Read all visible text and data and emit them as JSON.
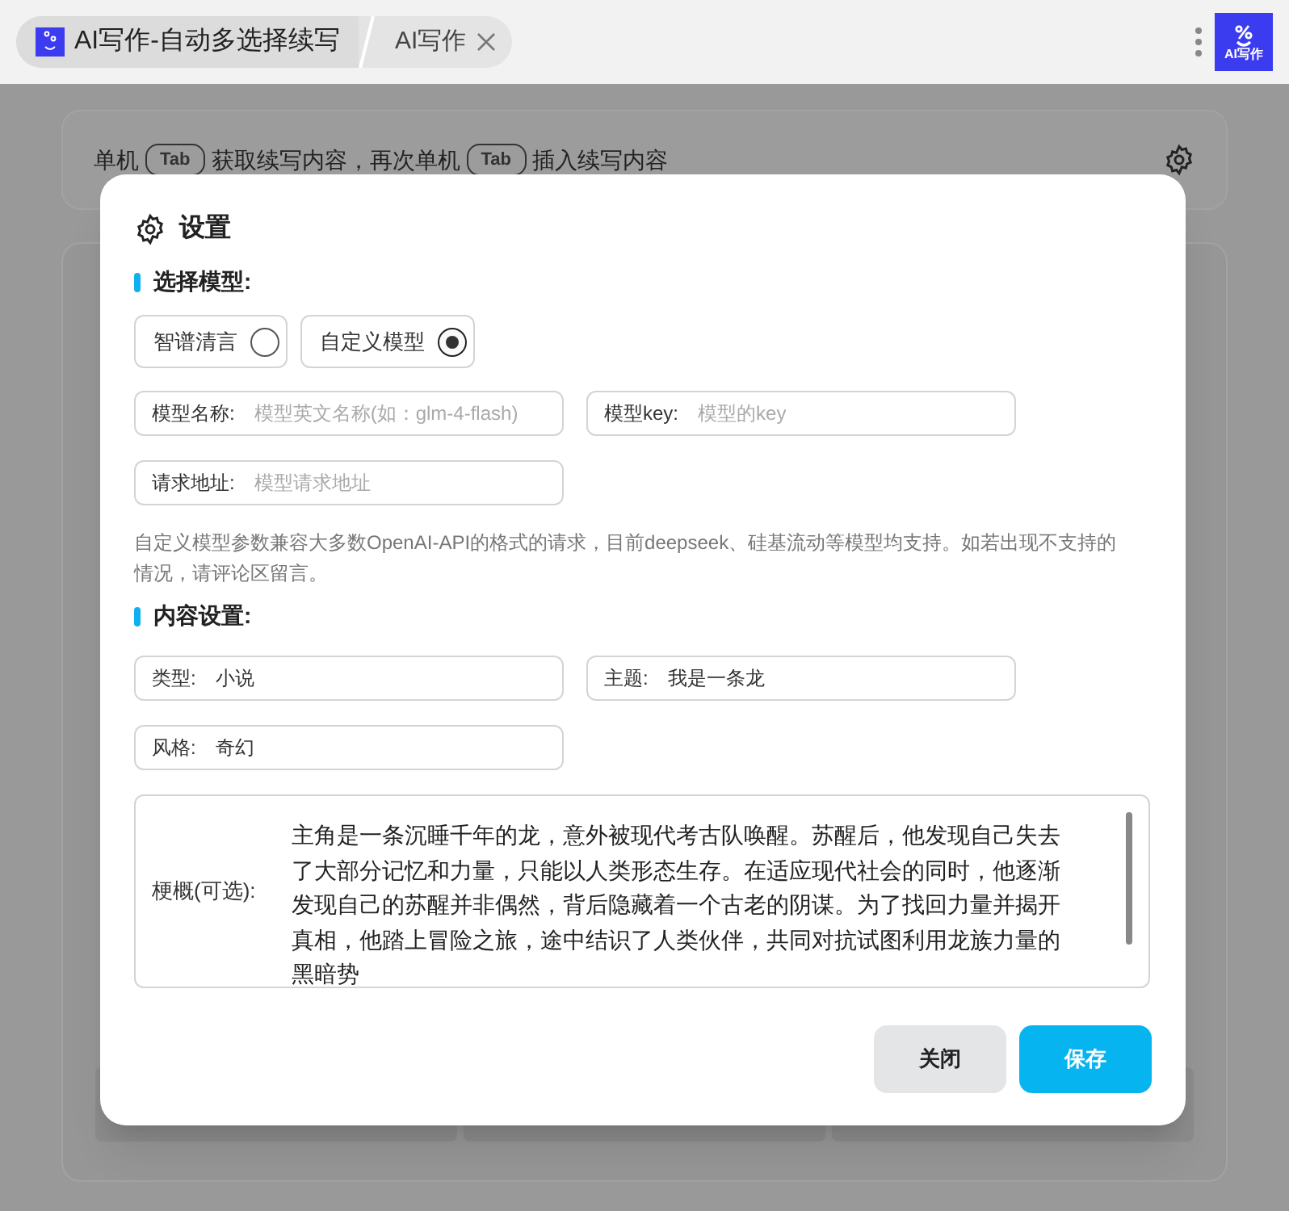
{
  "tabs": [
    {
      "label": "AI写作-自动多选择续写",
      "selected": true,
      "logo": true
    },
    {
      "label": "AI写作",
      "selected": false,
      "closable": true
    }
  ],
  "app_badge": {
    "label": "AI写作"
  },
  "hint_bar": {
    "parts": [
      {
        "kind": "text",
        "text": "单机"
      },
      {
        "kind": "key",
        "text": "Tab"
      },
      {
        "kind": "text",
        "text": "获取续写内容，再次单机"
      },
      {
        "kind": "key",
        "text": "Tab"
      },
      {
        "kind": "text",
        "text": "插入续写内容"
      }
    ]
  },
  "dialog": {
    "title": "设置",
    "model_section": {
      "heading": "选择模型:",
      "options": [
        {
          "label": "智谱清言",
          "selected": false
        },
        {
          "label": "自定义模型",
          "selected": true
        }
      ],
      "fields": [
        {
          "label": "模型名称:",
          "placeholder": "模型英文名称(如：glm-4-flash)"
        },
        {
          "label": "模型key:",
          "placeholder": "模型的key"
        },
        {
          "label": "请求地址:",
          "placeholder": "模型请求地址"
        }
      ],
      "note": "自定义模型参数兼容大多数OpenAI-API的格式的请求，目前deepseek、硅基流动等模型均支持。如若出现不支持的情况，请评论区留言。"
    },
    "content_section": {
      "heading": "内容设置:",
      "fields": [
        {
          "label": "类型:",
          "value": "小说"
        },
        {
          "label": "主题:",
          "value": "我是一条龙"
        },
        {
          "label": "风格:",
          "value": "奇幻"
        }
      ],
      "synopsis": {
        "label": "梗概(可选):",
        "value": "主角是一条沉睡千年的龙，意外被现代考古队唤醒。苏醒后，他发现自己失去了大部分记忆和力量，只能以人类形态生存。在适应现代社会的同时，他逐渐发现自己的苏醒并非偶然，背后隐藏着一个古老的阴谋。为了找回力量并揭开真相，他踏上冒险之旅，途中结识了人类伙伴，共同对抗试图利用龙族力量的黑暗势"
      }
    },
    "buttons": [
      {
        "label": "关闭",
        "kind": "secondary"
      },
      {
        "label": "保存",
        "kind": "primary"
      }
    ]
  }
}
